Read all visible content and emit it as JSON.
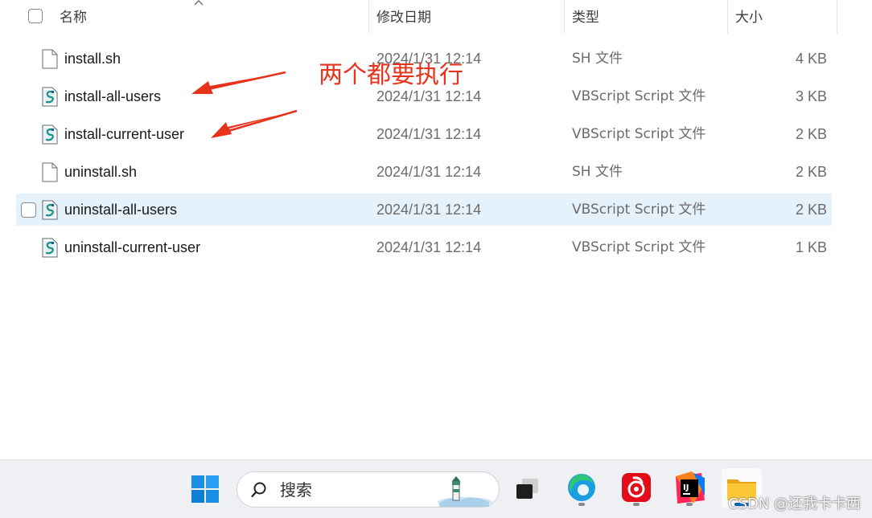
{
  "columns": {
    "name": "名称",
    "date": "修改日期",
    "type": "类型",
    "size": "大小"
  },
  "files": [
    {
      "name": "install.sh",
      "date": "2024/1/31 12:14",
      "type": "SH 文件",
      "size": "4 KB",
      "icon": "document-icon"
    },
    {
      "name": "install-all-users",
      "date": "2024/1/31 12:14",
      "type": "VBScript Script 文件",
      "size": "3 KB",
      "icon": "vbscript-icon"
    },
    {
      "name": "install-current-user",
      "date": "2024/1/31 12:14",
      "type": "VBScript Script 文件",
      "size": "2 KB",
      "icon": "vbscript-icon"
    },
    {
      "name": "uninstall.sh",
      "date": "2024/1/31 12:14",
      "type": "SH 文件",
      "size": "2 KB",
      "icon": "document-icon"
    },
    {
      "name": "uninstall-all-users",
      "date": "2024/1/31 12:14",
      "type": "VBScript Script 文件",
      "size": "2 KB",
      "icon": "vbscript-icon",
      "hovered": true
    },
    {
      "name": "uninstall-current-user",
      "date": "2024/1/31 12:14",
      "type": "VBScript Script 文件",
      "size": "1 KB",
      "icon": "vbscript-icon"
    }
  ],
  "annotation": {
    "text": "两个都要执行",
    "color": "#e8331c"
  },
  "taskbar": {
    "search_label": "搜索",
    "apps": [
      "windows-start-icon",
      "task-view-icon",
      "edge-icon",
      "netease-music-icon",
      "intellij-icon",
      "file-explorer-icon"
    ],
    "accent": "#0067c0"
  },
  "watermark": "CSDN @还我卡卡西"
}
